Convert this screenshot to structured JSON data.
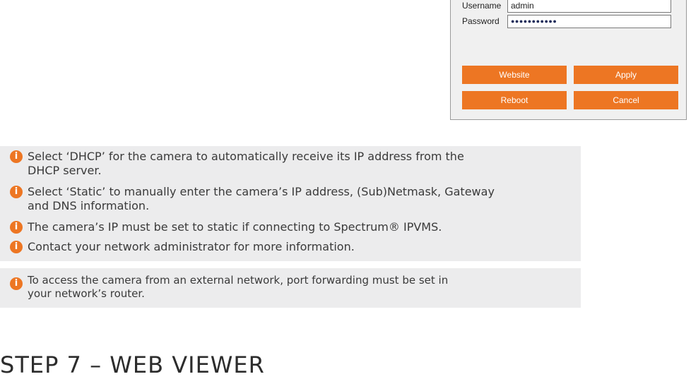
{
  "dialog": {
    "username_label": "Username",
    "username_value": "admin",
    "password_label": "Password",
    "password_value": "●●●●●●●●●●●",
    "buttons": {
      "website": "Website",
      "apply": "Apply",
      "reboot": "Reboot",
      "cancel": "Cancel"
    }
  },
  "notes": [
    {
      "line1": "Select ‘DHCP’ for the camera to automatically receive its IP address from the",
      "line2": "DHCP server."
    },
    {
      "line1": "Select ‘Static’ to manually enter the camera’s IP address, (Sub)Netmask, Gateway",
      "line2": "and DNS information."
    },
    {
      "line1": "The camera’s IP must be set to static if connecting to Spectrum® IPVMS."
    },
    {
      "line1": "Contact your network administrator for more information."
    }
  ],
  "note2": {
    "line1": "To access the camera from an external network, port forwarding must be set in",
    "line2": "your network’s router."
  },
  "icons": {
    "info": "info-icon"
  },
  "colors": {
    "accent": "#ed7623",
    "note_bg": "#ececed"
  },
  "section_heading": "STEP 7 – WEB VIEWER"
}
